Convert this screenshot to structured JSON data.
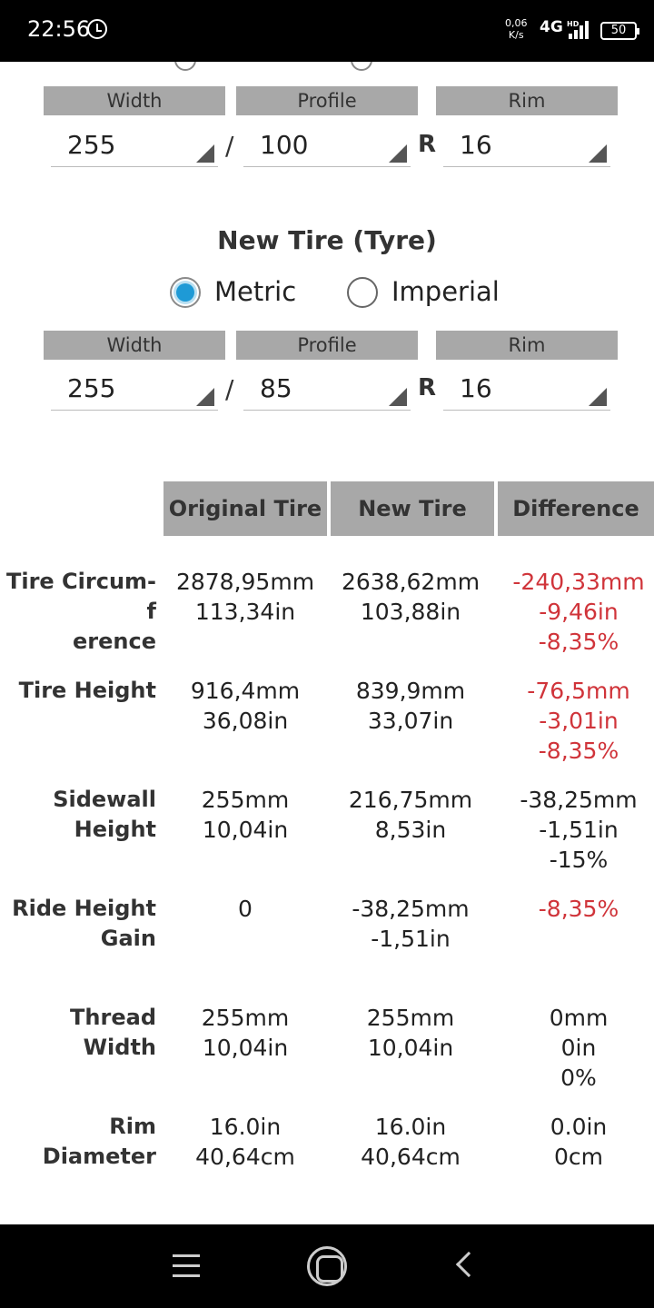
{
  "status_bar": {
    "time": "22:56",
    "speed": "0,06\nK/s",
    "network": "4G",
    "hd": "HD",
    "battery": "50"
  },
  "original_size": {
    "width_label": "Width",
    "profile_label": "Profile",
    "rim_label": "Rim",
    "width_value": "255",
    "profile_value": "100",
    "rim_value": "16",
    "separator": "/",
    "rim_prefix": "R"
  },
  "new_tire": {
    "title": "New Tire (Tyre)",
    "metric_label": "Metric",
    "imperial_label": "Imperial",
    "selected_unit": "Metric",
    "width_label": "Width",
    "profile_label": "Profile",
    "rim_label": "Rim",
    "width_value": "255",
    "profile_value": "85",
    "rim_value": "16",
    "separator": "/",
    "rim_prefix": "R"
  },
  "results": {
    "headers": [
      "Original Tire",
      "New Tire",
      "Difference"
    ],
    "rows": [
      {
        "label": "Tire Circum-f\nerence",
        "original": "2878,95mm\n113,34in",
        "new": "2638,62mm\n103,88in",
        "difference": "-240,33mm\n-9,46in\n-8,35%",
        "diff_color": "#d0343a"
      },
      {
        "label": "Tire Height",
        "original": "916,4mm\n36,08in",
        "new": "839,9mm\n33,07in",
        "difference": "-76,5mm\n-3,01in\n-8,35%",
        "diff_color": "#d0343a"
      },
      {
        "label": "Sidewall\nHeight",
        "original": "255mm\n10,04in",
        "new": "216,75mm\n8,53in",
        "difference": "-38,25mm\n-1,51in\n-15%",
        "diff_color": "#222222"
      },
      {
        "label": "Ride Height\nGain",
        "original": "0",
        "new": "-38,25mm\n-1,51in",
        "difference": "-8,35%",
        "diff_color": "#d0343a"
      },
      {
        "label": "Thread Width",
        "original": "255mm\n10,04in",
        "new": "255mm\n10,04in",
        "difference": "0mm\n0in\n0%",
        "diff_color": "#222222"
      },
      {
        "label": "Rim Diameter",
        "original": "16.0in\n40,64cm",
        "new": "16.0in\n40,64cm",
        "difference": "0.0in\n0cm",
        "diff_color": "#222222"
      }
    ]
  },
  "nav_bar": {
    "icons": [
      "menu-icon",
      "home-icon",
      "back-icon"
    ]
  }
}
